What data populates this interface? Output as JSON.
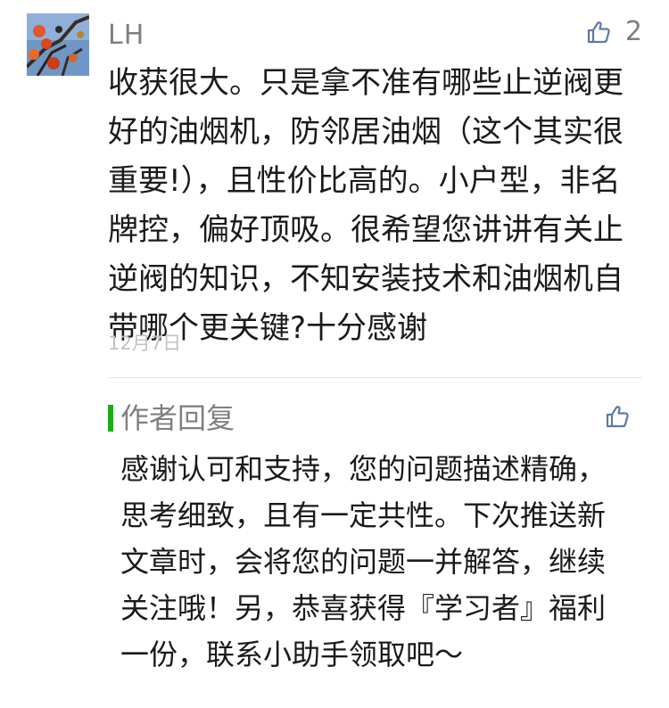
{
  "comment": {
    "username": "LH",
    "like_count": "2",
    "text": "收获很大。只是拿不准有哪些止逆阀更好的油烟机，防邻居油烟（这个其实很重要!），且性价比高的。小户型，非名牌控，偏好顶吸。很希望您讲讲有关止逆阀的知识，不知安装技术和油烟机自带哪个更关键?十分感谢",
    "date": "12月7日",
    "avatar_icon": "persimmon-branch-photo",
    "like_icon": "thumbs-up-icon"
  },
  "reply": {
    "label": "作者回复",
    "text": "感谢认可和支持，您的问题描述精确，思考细致，且有一定共性。下次推送新文章时，会将您的问题一并解答，继续关注哦！另，恭喜获得『学习者』福利一份，联系小助手领取吧～",
    "like_icon": "thumbs-up-icon",
    "accent_color": "#1aad19"
  }
}
